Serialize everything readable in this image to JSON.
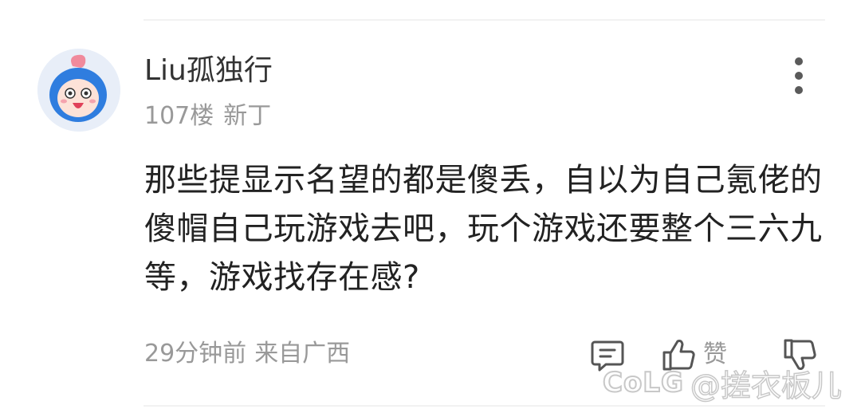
{
  "comment": {
    "username": "Liu孤独行",
    "floor": "107楼",
    "rank": "新丁",
    "body": "那些提显示名望的都是傻丢，自以为自己氪佬的傻帽自己玩游戏去吧，玩个游戏还要整个三六九等，游戏找存在感?",
    "time": "29分钟前",
    "location": "来自广西"
  },
  "actions": {
    "like_label": "赞"
  },
  "watermark": {
    "logo": "CoLG",
    "handle": "@搓衣板儿"
  },
  "icons": {
    "avatar": "cartoon-blue-hood-avatar",
    "more": "vertical-dots-icon",
    "comment": "comment-icon",
    "like": "thumbs-up-icon",
    "dislike": "thumbs-down-icon"
  },
  "colors": {
    "username": "#333333",
    "meta": "#999999",
    "body_text": "#222222",
    "avatar_bg": "#e8eef8",
    "avatar_hood": "#2f7ddf"
  }
}
